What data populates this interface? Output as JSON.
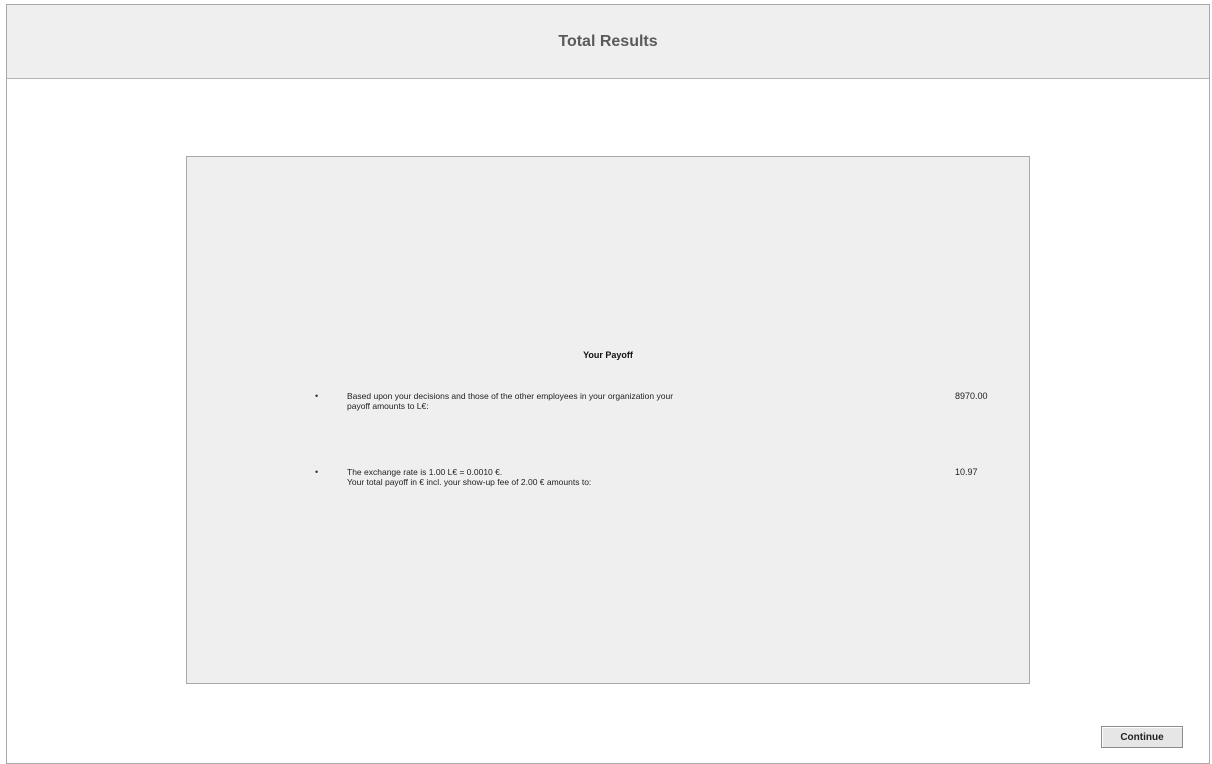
{
  "header": {
    "title": "Total Results"
  },
  "payoff": {
    "title": "Your Payoff",
    "items": [
      {
        "bullet": "•",
        "line1": "Based upon your decisions and those of the other employees in your organization your",
        "line2": "payoff amounts to L€:",
        "value": "8970.00"
      },
      {
        "bullet": "•",
        "line1": "The exchange rate is 1.00 L€ = 0.0010 €.",
        "line2": "Your total payoff in € incl. your show-up fee of 2.00 € amounts to:",
        "value": "10.97"
      }
    ]
  },
  "footer": {
    "continue_label": "Continue"
  }
}
